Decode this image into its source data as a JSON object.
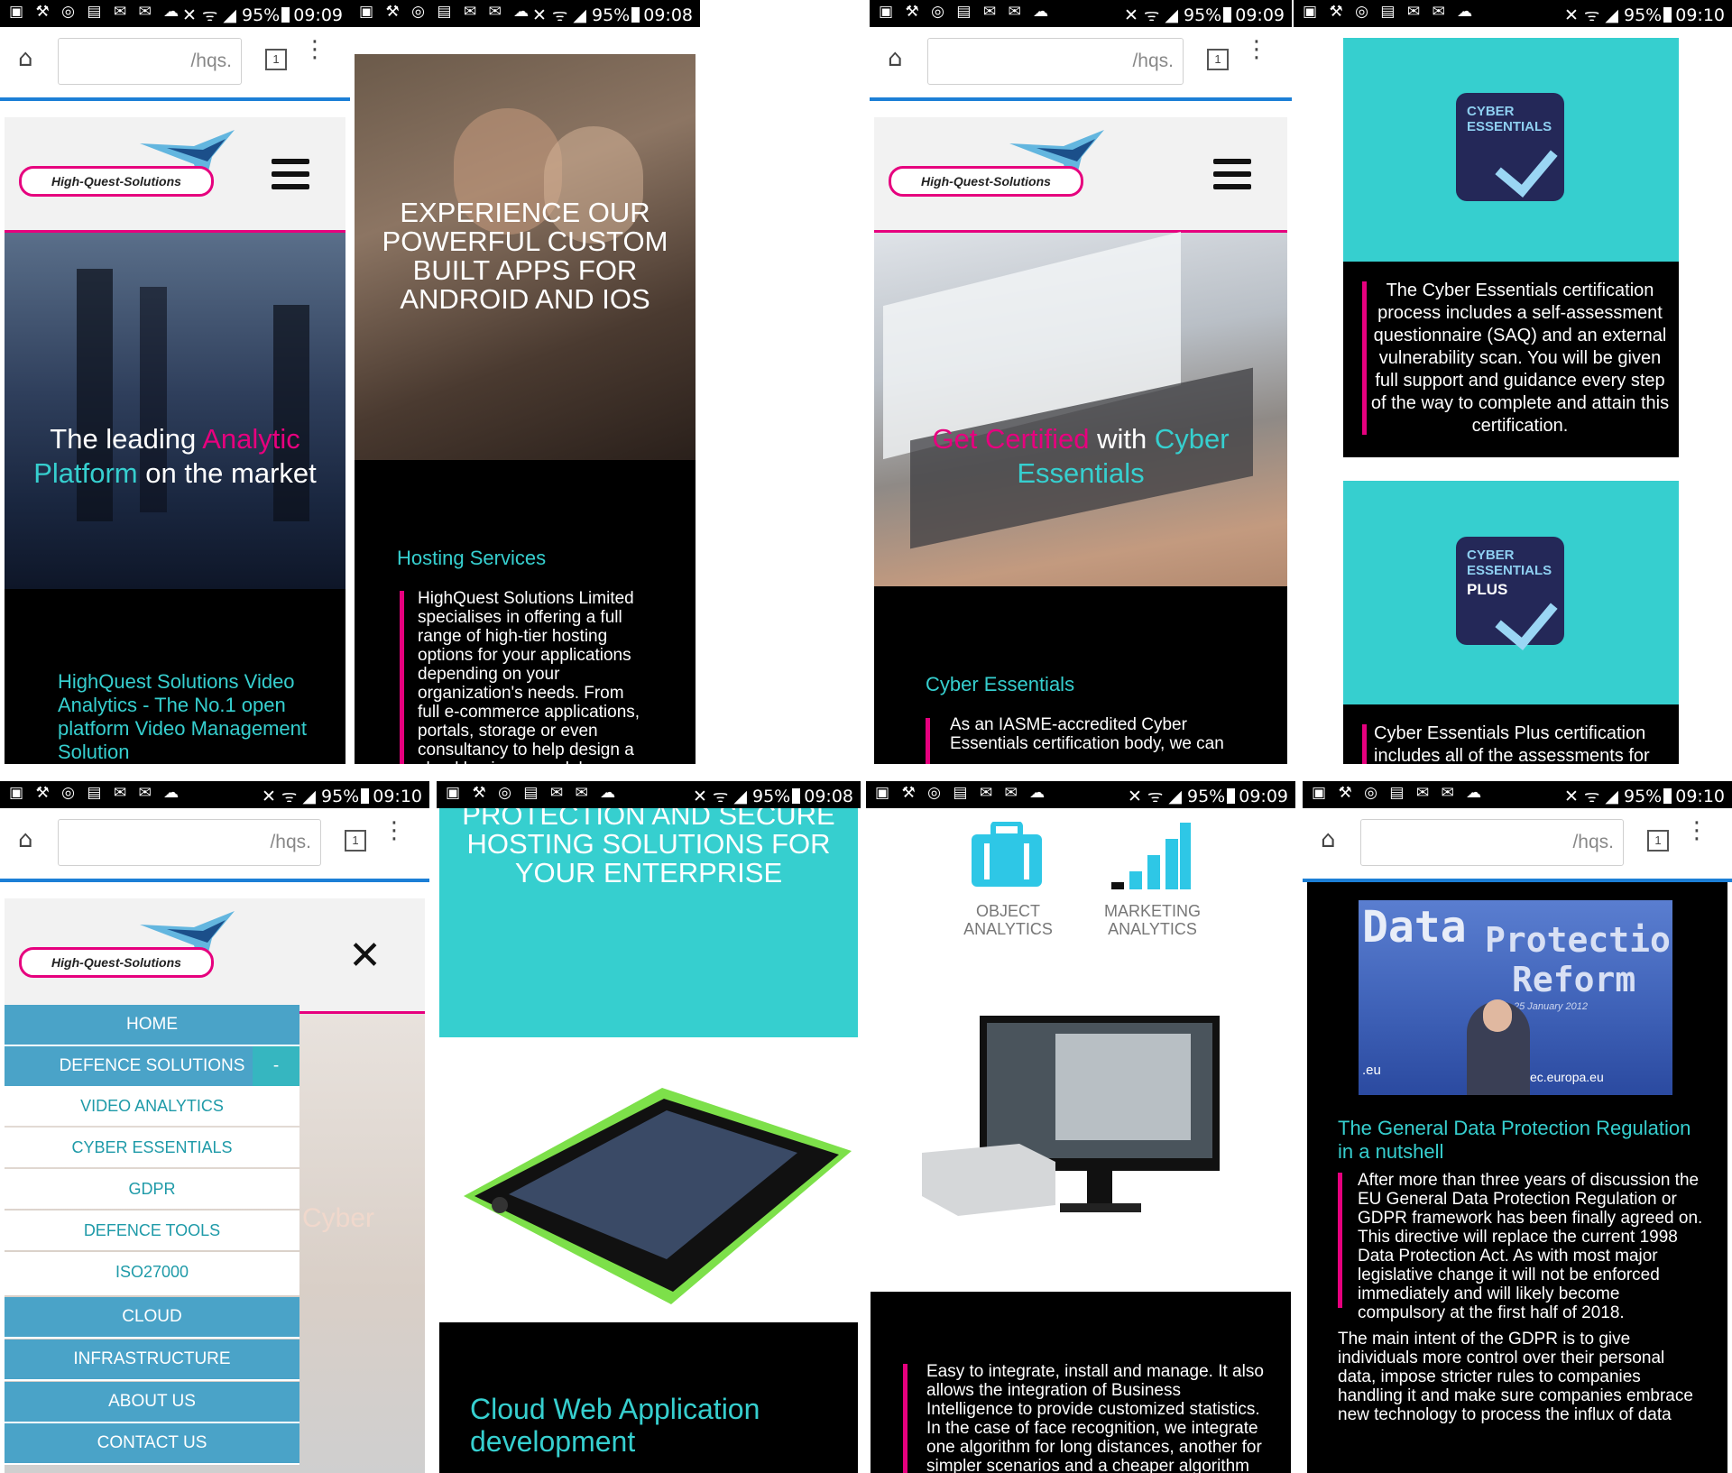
{
  "status_bars": {
    "s1": {
      "battery": "95%",
      "time": "09:09"
    },
    "s2": {
      "battery": "95%",
      "time": "09:08"
    },
    "s3": {
      "battery": "95%",
      "time": "09:09"
    },
    "s4": {
      "battery": "95%",
      "time": "09:10"
    },
    "s5": {
      "battery": "95%",
      "time": "09:10"
    },
    "s6": {
      "battery": "95%",
      "time": "09:08"
    },
    "s7": {
      "battery": "95%",
      "time": "09:09"
    },
    "s8": {
      "battery": "95%",
      "time": "09:10"
    }
  },
  "browser": {
    "url": "/hqs.",
    "tab_count": "1"
  },
  "brand": {
    "logo_text": "High-Quest-Solutions"
  },
  "s1": {
    "hero_pre": "The leading ",
    "hero_pink": "Analytic",
    "hero_teal": "Platform",
    "hero_post": " on the market",
    "heading": "HighQuest Solutions Video Analytics - The No.1 open platform Video Management Solution"
  },
  "s2": {
    "hero": "EXPERIENCE OUR POWERFUL CUSTOM BUILT APPS FOR ANDROID AND IOS",
    "heading": "Hosting Services",
    "body": "HighQuest Solutions Limited specialises in offering a full range of high-tier hosting options for your applications depending on your organization's needs. From full e-commerce applications, portals, storage or even consultancy to help design a cloud business model – we can provide a fully bespoke system."
  },
  "s3": {
    "hero_pink": "Get Certified",
    "hero_mid": " with ",
    "hero_teal": "Cyber Essentials",
    "heading": "Cyber Essentials",
    "body": "As an IASME-accredited Cyber Essentials certification body, we can"
  },
  "s4": {
    "badge1_line1": "CYBER",
    "badge1_line2": "ESSENTIALS",
    "body1": "The Cyber Essentials certification process includes a self-assessment questionnaire (SAQ) and an external vulnerability scan. You will be given full support and guidance every step of the way to complete and attain this certification.",
    "badge2_line1": "CYBER",
    "badge2_line2": "ESSENTIALS",
    "badge2_plus": "PLUS",
    "body2": "Cyber Essentials Plus certification includes all of the assessments for"
  },
  "s5": {
    "menu": {
      "home": "HOME",
      "defence": "DEFENCE SOLUTIONS",
      "defence_toggle": "-",
      "sub": [
        "VIDEO ANALYTICS",
        "CYBER ESSENTIALS",
        "GDPR",
        "DEFENCE TOOLS",
        "ISO27000"
      ],
      "cloud": "CLOUD",
      "infrastructure": "INFRASTRUCTURE",
      "about": "ABOUT US",
      "contact": "CONTACT US"
    },
    "bg_fragment": "Cyber"
  },
  "s6": {
    "banner": "PROTECTION AND SECURE HOSTING SOLUTIONS FOR YOUR ENTERPRISE",
    "heading": "Cloud Web Application development"
  },
  "s7": {
    "feature1": "OBJECT ANALYTICS",
    "feature2": "MARKETING ANALYTICS",
    "body": "Easy to integrate, install and manage. It also allows the integration of Business Intelligence to provide customized statistics. In the case of face recognition, we integrate one algorithm for long distances, another for simpler scenarios and a cheaper algorithm"
  },
  "s8": {
    "image_title1": "Data",
    "image_title2": "Protection",
    "image_title3": "Reform",
    "image_date": "25 January 2012",
    "image_url": "ec.europa.eu",
    "image_eu": ".eu",
    "heading": "The General Data Protection Regulation in a nutshell",
    "body1": "After more than three years of discussion the EU General Data Protection Regulation or GDPR framework has been finally agreed on. This directive will replace the current 1998 Data Protection Act. As with most major legislative change it will not be enforced immediately and will likely become compulsory at the first half of 2018.",
    "body2": "The main intent of the GDPR is to give individuals more control over their personal data, impose stricter rules to companies handling it and make sure companies embrace new technology to process the influx of data"
  },
  "colors": {
    "accent_pink": "#e6007e",
    "accent_teal": "#36cfcf",
    "url_underline": "#1c7fd6",
    "menu_blue": "#4aa3c8"
  }
}
